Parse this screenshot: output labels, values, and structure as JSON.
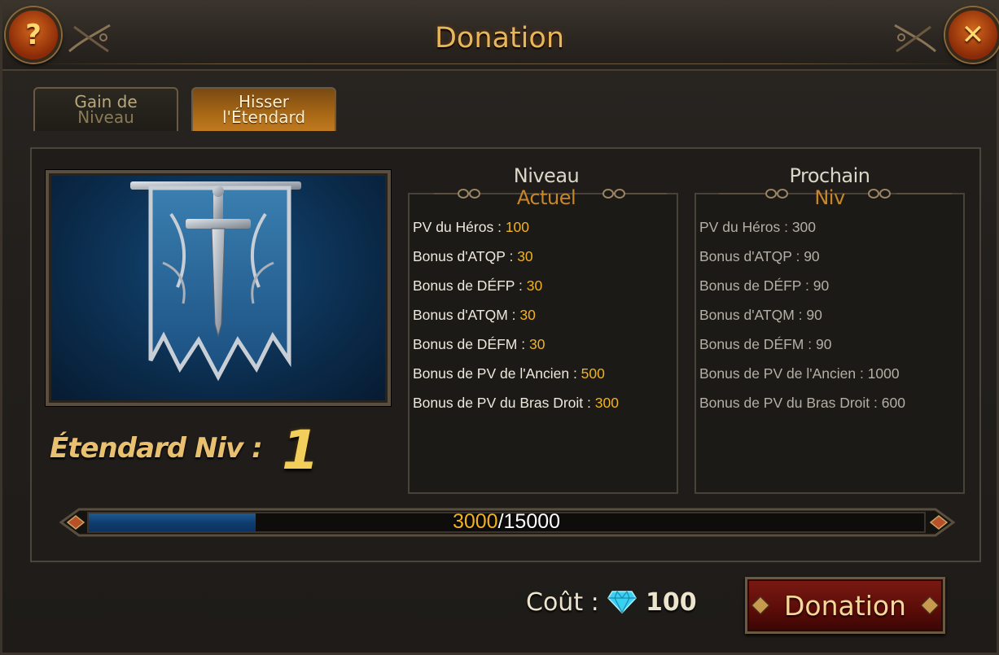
{
  "window": {
    "title": "Donation",
    "help_label": "?",
    "close_label": "✕"
  },
  "tabs": [
    {
      "line1": "Gain de",
      "line2": "Niveau",
      "active": false
    },
    {
      "line1": "Hisser",
      "line2": "l'Étendard",
      "active": true
    }
  ],
  "standard": {
    "level_label": "Étendard Niv :",
    "level_value": "1"
  },
  "current": {
    "title_line1": "Niveau",
    "title_line2": "Actuel",
    "rows": [
      {
        "label": "PV du Héros : ",
        "value": "100"
      },
      {
        "label": "Bonus d'ATQP : ",
        "value": "30"
      },
      {
        "label": "Bonus de DÉFP : ",
        "value": "30"
      },
      {
        "label": "Bonus d'ATQM : ",
        "value": "30"
      },
      {
        "label": "Bonus de DÉFM : ",
        "value": "30"
      },
      {
        "label": "Bonus de PV de l'Ancien : ",
        "value": "500"
      },
      {
        "label": "Bonus de PV du Bras Droit : ",
        "value": "300"
      }
    ]
  },
  "next": {
    "title_line1": "Prochain",
    "title_line2": "Niv",
    "rows": [
      {
        "label": "PV du Héros : ",
        "value": "300"
      },
      {
        "label": "Bonus d'ATQP : ",
        "value": "90"
      },
      {
        "label": "Bonus de DÉFP : ",
        "value": "90"
      },
      {
        "label": "Bonus d'ATQM : ",
        "value": "90"
      },
      {
        "label": "Bonus de DÉFM : ",
        "value": "90"
      },
      {
        "label": "Bonus de PV de l'Ancien : ",
        "value": "1000"
      },
      {
        "label": "Bonus de PV du Bras Droit : ",
        "value": "600"
      }
    ]
  },
  "progress": {
    "current": "3000",
    "separator": "/",
    "max": "15000",
    "fraction": 0.2
  },
  "cost": {
    "label": "Coût :",
    "value": "100",
    "currency_icon": "diamond-icon"
  },
  "donate_button": {
    "label": "Donation"
  },
  "colors": {
    "title": "#e8b65a",
    "stat_value": "#f2b21e",
    "progress_fill": "#1e5a92"
  }
}
